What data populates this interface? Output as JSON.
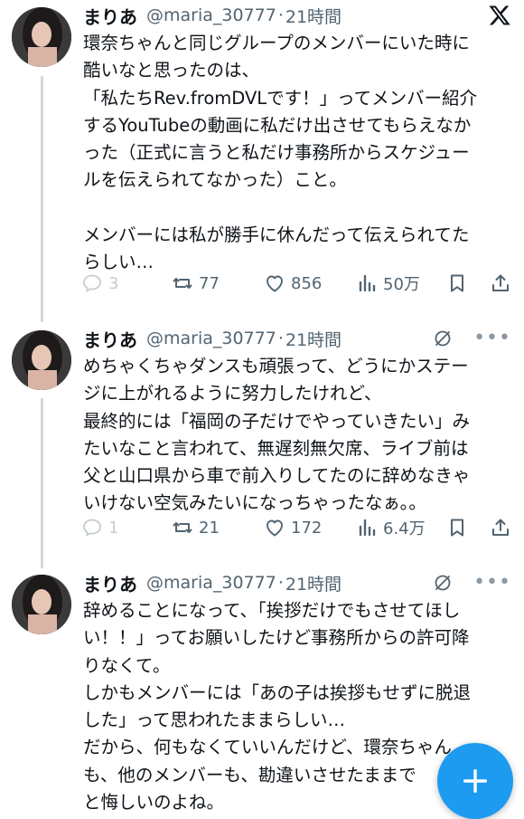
{
  "colors": {
    "accent": "#1d9bf0",
    "text": "#0f1419",
    "muted": "#536471",
    "thread_line": "#cfd9de"
  },
  "tweets": [
    {
      "name": "まりあ",
      "handle": "@maria_30777",
      "separator": "·",
      "time": "21時間",
      "header_icon": "x-logo-icon",
      "body": "環奈ちゃんと同じグループのメンバーにいた時に\n酷いなと思ったのは、\n「私たちRev.fromDVLです！」ってメンバー紹介\nするYouTubeの動画に私だけ出させてもらえなか\nった（正式に言うと私だけ事務所からスケジュー\nルを伝えられてなかった）こと。\n\nメンバーには私が勝手に休んだって伝えられてた\nらしい…",
      "replies": "3",
      "retweets": "77",
      "likes": "856",
      "views": "50万"
    },
    {
      "name": "まりあ",
      "handle": "@maria_30777",
      "separator": "·",
      "time": "21時間",
      "header_icon": "grok-icon",
      "body": "めちゃくちゃダンスも頑張って、どうにかステー\nジに上がれるように努力したけれど、\n最終的には「福岡の子だけでやっていきたい」み\nたいなこと言われて、無遅刻無欠席、ライブ前は\n父と山口県から車で前入りしてたのに辞めなきゃ\nいけない空気みたいになっちゃったなぁ。。",
      "replies": "1",
      "retweets": "21",
      "likes": "172",
      "views": "6.4万"
    },
    {
      "name": "まりあ",
      "handle": "@maria_30777",
      "separator": "·",
      "time": "21時間",
      "header_icon": "grok-icon",
      "body": "辞めることになって、「挨拶だけでもさせてほし\nい！！」ってお願いしたけど事務所からの許可降\nりなくて。\nしかもメンバーには「あの子は挨拶もせずに脱退\nした」って思われたままらしい…\nだから、何もなくていいんだけど、環奈ちゃん\nも、他のメンバーも、勘違いさせたままで\nと悔しいのよね。"
    }
  ]
}
